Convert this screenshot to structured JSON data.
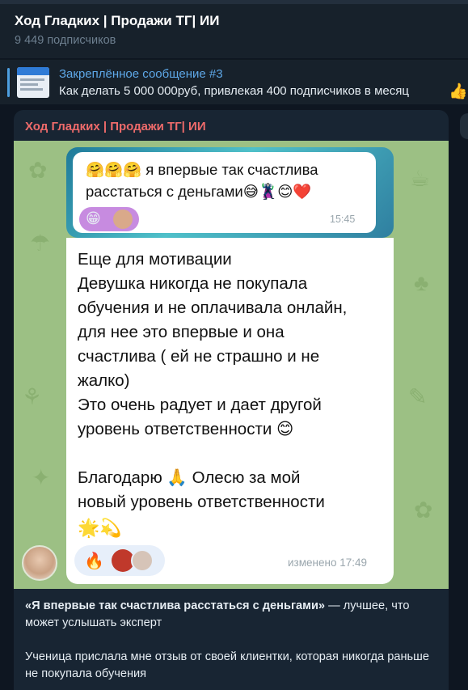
{
  "header": {
    "title": "Ход Гладких | Продажи ТГ| ИИ",
    "subscribers": "9 449 подписчиков"
  },
  "pinned": {
    "label": "Закреплённое сообщение #3",
    "text": "Как делать 5 000 000руб, привлекая 400 подписчиков в месяц",
    "emoji": "👍"
  },
  "post": {
    "author": "Ход Гладких | Продажи ТГ| ИИ",
    "screenshot": {
      "quoted": {
        "emoji_prefix": "🤗🤗🤗",
        "text_line1": "я впервые так счастлива",
        "text_line2": "расстаться с деньгами",
        "emoji_suffix": "😅🦹😊❤️",
        "reaction_emoji": "😁",
        "time": "15:45"
      },
      "message": {
        "lines": [
          "Еще для мотивации",
          "Девушка никогда не покупала",
          "обучения и не оплачивала онлайн,",
          "для нее это впервые и она",
          "счастлива ( ей не страшно и не",
          "жалко)",
          "Это очень радует и дает другой",
          "уровень ответственности 😊",
          "",
          "Благодарю 🙏 Олесю за мой",
          "новый уровень ответственности"
        ],
        "emoji_row": "🌟💫",
        "reaction_emoji": "🔥",
        "edited": "изменено 17:49"
      }
    },
    "caption": {
      "bold": "«Я впервые так счастлива расстаться с деньгами»",
      "rest": " — лучшее, что может услышать эксперт",
      "paragraph2": "Ученица прислала мне отзыв от своей клиентки, которая никогда раньше не покупала обучения"
    }
  },
  "colors": {
    "background": "#0e1621",
    "header": "#17212b",
    "accent": "#5ea8e8",
    "author": "#ef6b6b",
    "bubble": "#182533",
    "chat_bg": "#9cc084"
  }
}
